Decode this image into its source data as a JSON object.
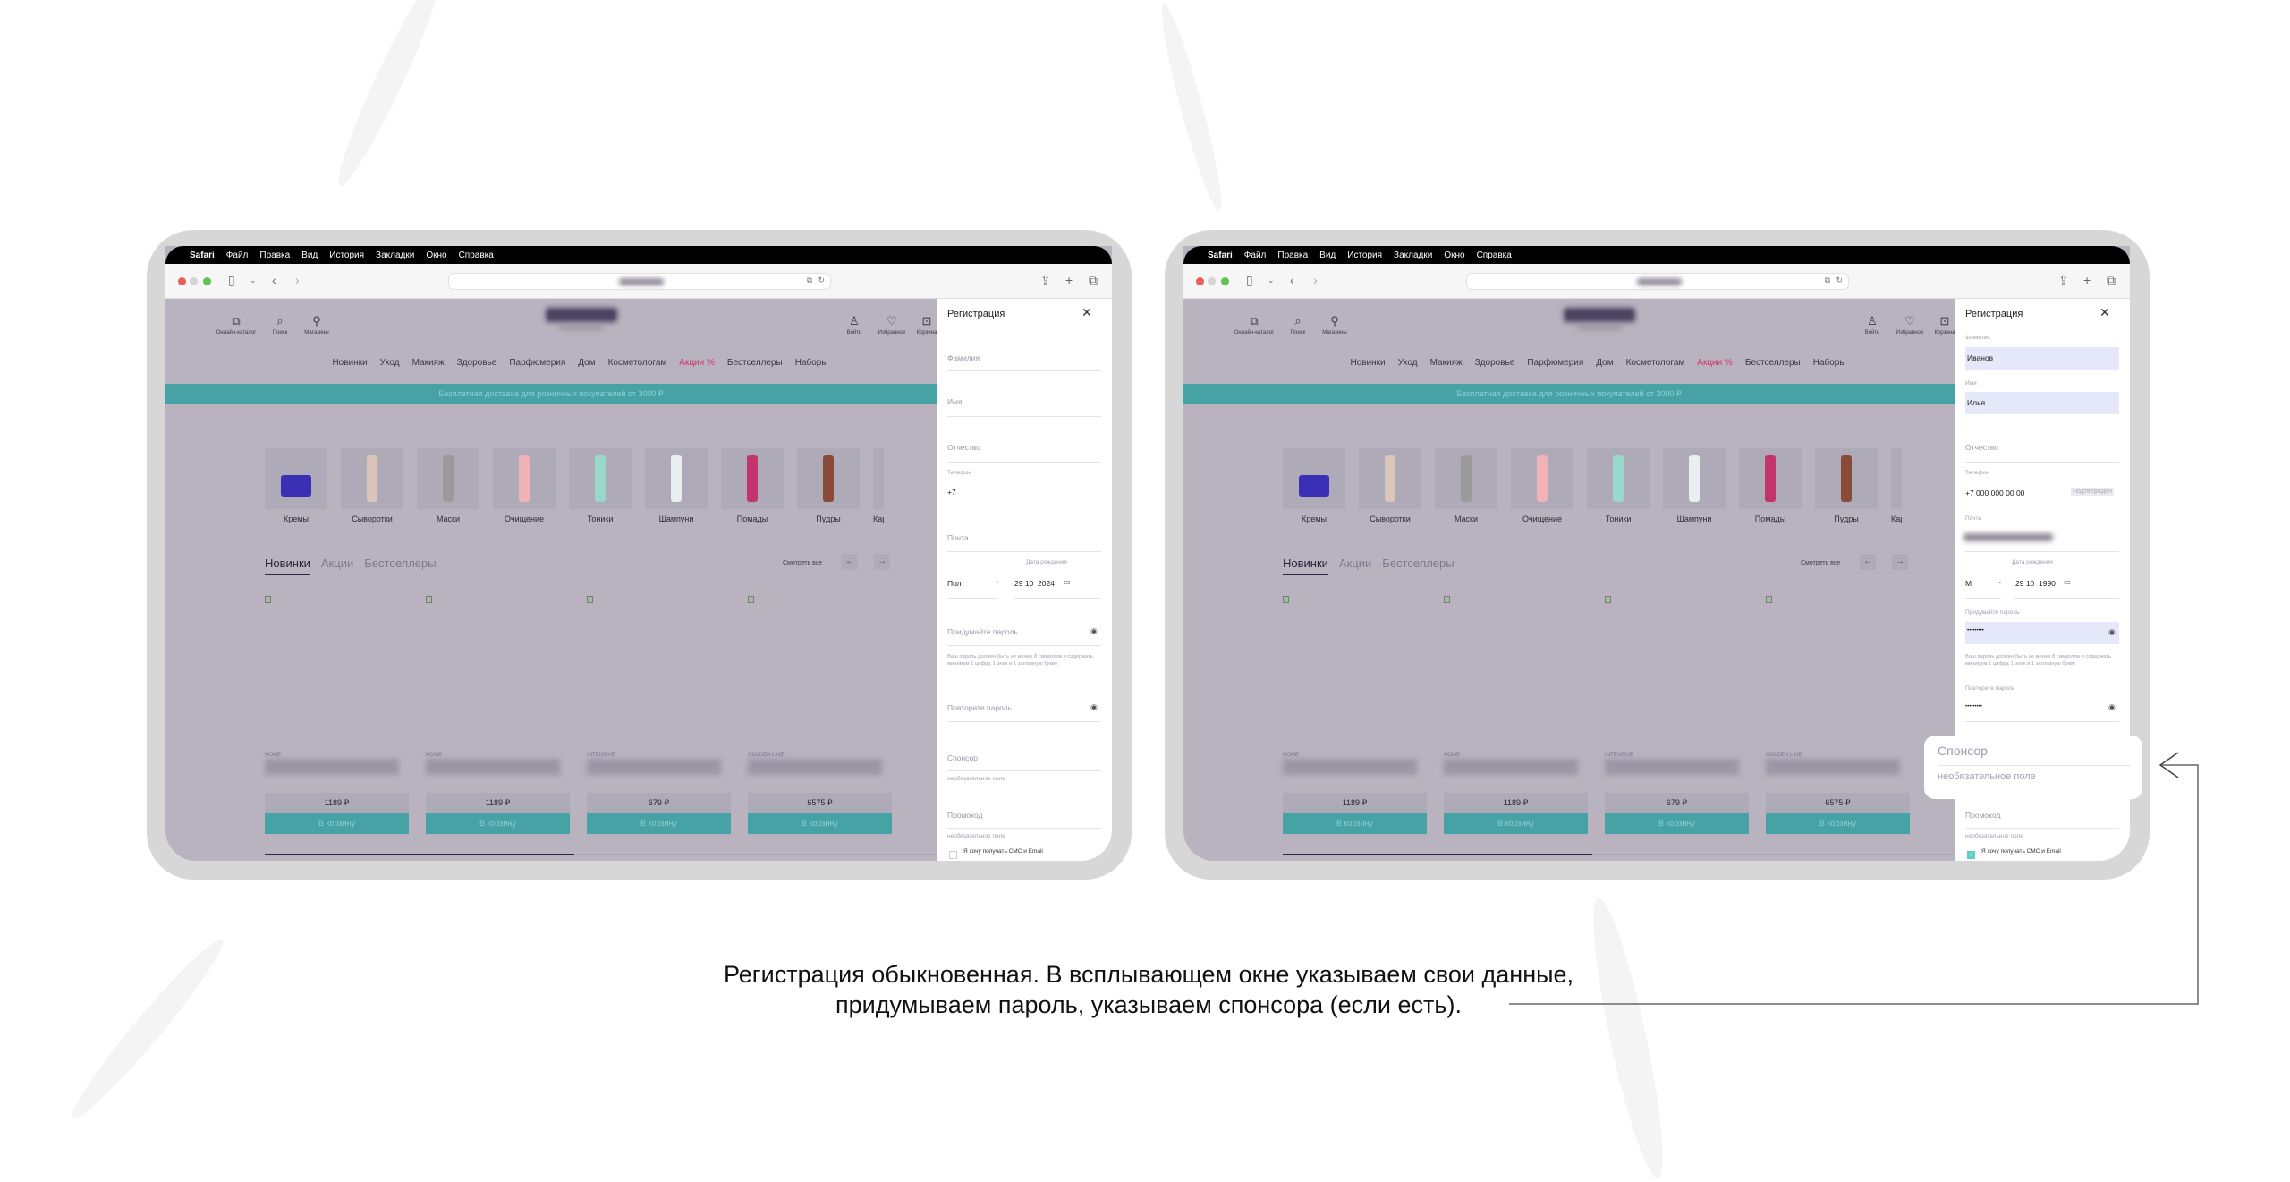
{
  "menubar": {
    "apple_icon": "apple-logo",
    "items": [
      "Safari",
      "Файл",
      "Правка",
      "Вид",
      "История",
      "Закладки",
      "Окно",
      "Справка"
    ]
  },
  "site": {
    "header_left": [
      {
        "icon": "book-icon",
        "label": "Онлайн-каталог"
      },
      {
        "icon": "search-icon",
        "label": "Поиск"
      },
      {
        "icon": "map-pin-icon",
        "label": "Магазины"
      }
    ],
    "header_right": [
      {
        "icon": "user-icon",
        "label": "Войти"
      },
      {
        "icon": "heart-icon",
        "label": "Избранное"
      },
      {
        "icon": "bag-icon",
        "label": "Корзина"
      }
    ],
    "nav": [
      "Новинки",
      "Уход",
      "Макияж",
      "Здоровье",
      "Парфюмерия",
      "Дом",
      "Косметологам",
      "Акции %",
      "Бестселлеры",
      "Наборы"
    ],
    "nav_highlight_color": "#d0306a",
    "banner": "Бесплатная доставка для розничных покупателей от 3000 ₽",
    "categories": [
      "Кремы",
      "Сыворотки",
      "Маски",
      "Очищение",
      "Тоники",
      "Шампуни",
      "Помады",
      "Пудры",
      "Карандаши"
    ],
    "tabs": [
      "Новинки",
      "Акции",
      "Бестселлеры"
    ],
    "see_all": "Смотреть все",
    "products": [
      {
        "brand": "HOME",
        "price": "1189 ₽"
      },
      {
        "brand": "HOME",
        "price": "1189 ₽"
      },
      {
        "brand": "INTENSIVE",
        "price": "679 ₽"
      },
      {
        "brand": "GOLDEN LINE",
        "price": "6575 ₽"
      }
    ],
    "cart_label": "В корзину",
    "accent": "#46a2a4"
  },
  "form_empty": {
    "title": "Регистрация",
    "last_name": "Фамилия",
    "first_name": "Имя",
    "middle_name": "Отчество",
    "phone_label": "Телефон",
    "phone_value": "+7",
    "email": "Почта",
    "birth_label": "Дата рождения",
    "gender": "Пол",
    "birth_value": "29 10  2024",
    "password": "Придумайте пароль",
    "password_help": "Ваш пароль должен быть не менее 8 символов и содержать минимум 1 цифру, 1 знак и 1 заглавную букву.",
    "repeat_password": "Повторите пароль",
    "sponsor": "Спонсор",
    "optional": "необязательное поле",
    "promo": "Промокод",
    "consent": "Я хочу получать СМС и Email"
  },
  "form_filled": {
    "title": "Регистрация",
    "last_name_label": "Фамилия",
    "last_name": "Иванов",
    "first_name_label": "Имя",
    "first_name": "Илья",
    "middle_name": "Отчество",
    "phone_label": "Телефон",
    "phone_value": "+7 000 000 00 00",
    "phone_status": "Подтвержден",
    "email_label": "Почта",
    "birth_label": "Дата рождения",
    "gender": "М",
    "birth_value": "29 10  1990",
    "password_label": "Придумайте пароль",
    "password_value": "•••••••••",
    "password_help": "Ваш пароль должен быть не менее 8 символов и содержать минимум 1 цифру, 1 знак и 1 заглавную букву.",
    "repeat_label": "Повторите пароль",
    "repeat_value": "•••••••••",
    "promo": "Промокод",
    "optional": "необязательное поле",
    "consent": "Я хочу получать СМС и Email",
    "consent_checked": true
  },
  "callout": {
    "sponsor": "Спонсор",
    "optional": "необязательное поле"
  },
  "caption": {
    "line1": "Регистрация обыкновенная. В всплывающем окне указываем свои данные,",
    "line2": "придумываем пароль, указываем спонсора (если есть)."
  }
}
